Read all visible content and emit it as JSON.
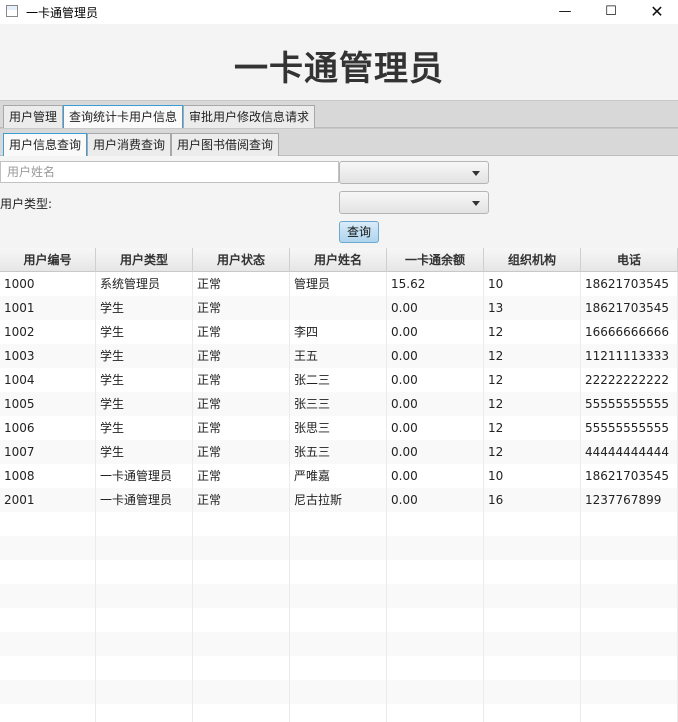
{
  "window": {
    "title": "一卡通管理员"
  },
  "header": {
    "title": "一卡通管理员"
  },
  "tabs": [
    {
      "label": "用户管理"
    },
    {
      "label": "查询统计卡用户信息"
    },
    {
      "label": "审批用户修改信息请求"
    }
  ],
  "subtabs": [
    {
      "label": "用户信息查询"
    },
    {
      "label": "用户消费查询"
    },
    {
      "label": "用户图书借阅查询"
    }
  ],
  "filters": {
    "name_placeholder": "用户姓名",
    "name_value": "",
    "user_type_label": "用户类型:",
    "query_button": "查询"
  },
  "table": {
    "columns": [
      "用户编号",
      "用户类型",
      "用户状态",
      "用户姓名",
      "一卡通余额",
      "组织机构",
      "电话"
    ],
    "rows": [
      [
        "1000",
        "系统管理员",
        "正常",
        "管理员",
        "15.62",
        "10",
        "18621703545"
      ],
      [
        "1001",
        "学生",
        "正常",
        "",
        "0.00",
        "13",
        "18621703545"
      ],
      [
        "1002",
        "学生",
        "正常",
        "李四",
        "0.00",
        "12",
        "16666666666"
      ],
      [
        "1003",
        "学生",
        "正常",
        "王五",
        "0.00",
        "12",
        "11211113333"
      ],
      [
        "1004",
        "学生",
        "正常",
        "张二三",
        "0.00",
        "12",
        "22222222222"
      ],
      [
        "1005",
        "学生",
        "正常",
        "张三三",
        "0.00",
        "12",
        "55555555555"
      ],
      [
        "1006",
        "学生",
        "正常",
        "张思三",
        "0.00",
        "12",
        "55555555555"
      ],
      [
        "1007",
        "学生",
        "正常",
        "张五三",
        "0.00",
        "12",
        "44444444444"
      ],
      [
        "1008",
        "一卡通管理员",
        "正常",
        "严唯嘉",
        "0.00",
        "10",
        "18621703545"
      ],
      [
        "2001",
        "一卡通管理员",
        "正常",
        "尼古拉斯",
        "0.00",
        "16",
        "1237767899"
      ]
    ]
  }
}
